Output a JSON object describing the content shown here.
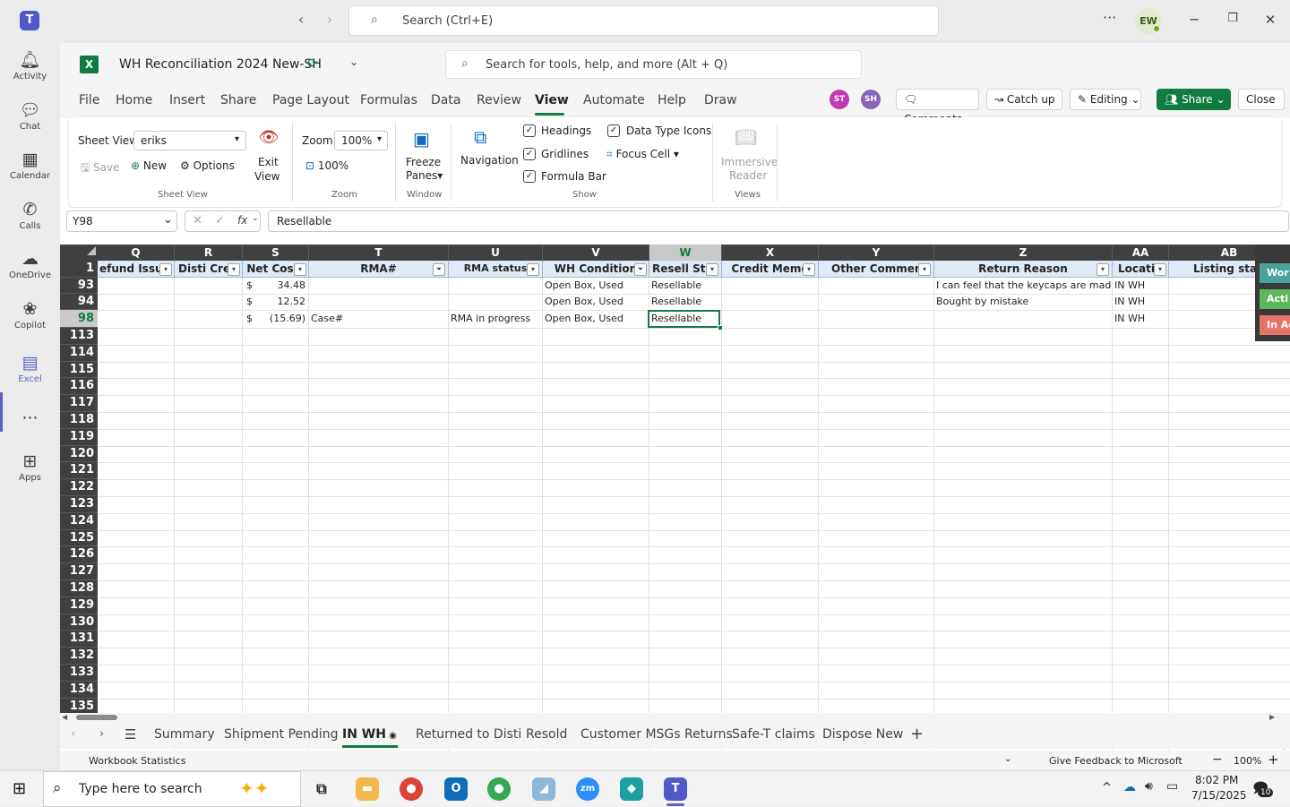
{
  "teams": {
    "search_placeholder": "Search (Ctrl+E)",
    "avatar_initials": "EW",
    "rail": [
      {
        "label": "Activity",
        "icon": "bell-icon"
      },
      {
        "label": "Chat",
        "icon": "chat-icon"
      },
      {
        "label": "Calendar",
        "icon": "calendar-icon"
      },
      {
        "label": "Calls",
        "icon": "phone-icon"
      },
      {
        "label": "OneDrive",
        "icon": "cloud-icon"
      },
      {
        "label": "Copilot",
        "icon": "copilot-icon"
      },
      {
        "label": "Excel",
        "icon": "excel-icon"
      },
      {
        "label": "Apps",
        "icon": "apps-plus-icon"
      }
    ]
  },
  "excel": {
    "doc_title": "WH Reconciliation 2024 New-SH",
    "search_placeholder": "Search for tools, help, and more (Alt + Q)",
    "menu_tabs": [
      "File",
      "Home",
      "Insert",
      "Share",
      "Page Layout",
      "Formulas",
      "Data",
      "Review",
      "View",
      "Automate",
      "Help",
      "Draw"
    ],
    "active_tab": "View",
    "collaborators": [
      {
        "initials": "ST",
        "color": "#c239b3"
      },
      {
        "initials": "SH",
        "color": "#8764b8"
      }
    ],
    "comments_label": "Comments",
    "catchup_label": "Catch up",
    "editing_label": "Editing",
    "share_label": "Share",
    "close_label": "Close",
    "ribbon": {
      "sheet_view_label": "Sheet View",
      "sheet_view_value": "eriks",
      "save_label": "Save",
      "new_label": "New",
      "options_label": "Options",
      "exit_view_1": "Exit",
      "exit_view_2": "View",
      "group_sheet_view": "Sheet View",
      "zoom_label": "Zoom",
      "zoom_value": "100%",
      "zoom_100_label": "100%",
      "group_zoom": "Zoom",
      "freeze_1": "Freeze",
      "freeze_2": "Panes",
      "group_window": "Window",
      "navigation_label": "Navigation",
      "headings_label": "Headings",
      "gridlines_label": "Gridlines",
      "formula_bar_label": "Formula Bar",
      "data_type_icons_label": "Data Type Icons",
      "focus_cell_label": "Focus Cell",
      "group_show": "Show",
      "immersive_1": "Immersive",
      "immersive_2": "Reader",
      "group_views": "Views"
    },
    "name_box": "Y98",
    "formula_value": "Resellable",
    "columns": [
      "Q",
      "R",
      "S",
      "T",
      "U",
      "V",
      "W",
      "X",
      "Y",
      "Z",
      "AA",
      "AB"
    ],
    "selected_column": "W",
    "header_cells": [
      "efund Issue",
      "Disti Cred",
      "Net Cos",
      "RMA#",
      "RMA status",
      "WH Condition",
      "Resell Stat",
      "Credit Memo",
      "Other Comment",
      "Return Reason",
      "Locatio",
      "Listing status"
    ],
    "header_row_number": "1",
    "data_rows": [
      {
        "row": "93",
        "currency": "$",
        "net_cost": "34.48",
        "rma": "",
        "rma_status": "",
        "wh_condition": "Open Box, Used",
        "resell": "Resellable",
        "return_reason": "I can feel that the keycaps are made",
        "location": "IN WH"
      },
      {
        "row": "94",
        "currency": "$",
        "net_cost": "12.52",
        "rma": "",
        "rma_status": "",
        "wh_condition": "Open Box, Used",
        "resell": "Resellable",
        "return_reason": "Bought by mistake",
        "location": "IN WH"
      },
      {
        "row": "98",
        "currency": "$",
        "net_cost": "(15.69)",
        "rma": "Case#",
        "rma_status": "RMA in progress",
        "wh_condition": "Open Box, Used",
        "resell": "Resellable",
        "return_reason": "",
        "location": "IN WH"
      }
    ],
    "selected_row": "98",
    "empty_rows": [
      "113",
      "114",
      "115",
      "116",
      "117",
      "118",
      "119",
      "120",
      "121",
      "122",
      "123",
      "124",
      "125",
      "126",
      "127",
      "128",
      "129",
      "130",
      "131",
      "132",
      "133",
      "134",
      "135"
    ],
    "side_tabs": [
      {
        "label": "Wor",
        "color": "#4aa39a"
      },
      {
        "label": "Acti",
        "color": "#5cb85c"
      },
      {
        "label": "In Ac",
        "color": "#e57368"
      }
    ],
    "sheet_tabs": [
      "Summary",
      "Shipment Pending",
      "IN WH",
      "Returned to Disti",
      "Resold",
      "Customer MSGs Returns",
      "Safe-T claims",
      "Dispose New"
    ],
    "active_sheet": "IN WH",
    "status_left": "Workbook Statistics",
    "feedback_label": "Give Feedback to Microsoft",
    "zoom_status": "100%"
  },
  "taskbar": {
    "search_placeholder": "Type here to search",
    "time": "8:02 PM",
    "date": "7/15/2025",
    "notification_count": "10"
  }
}
